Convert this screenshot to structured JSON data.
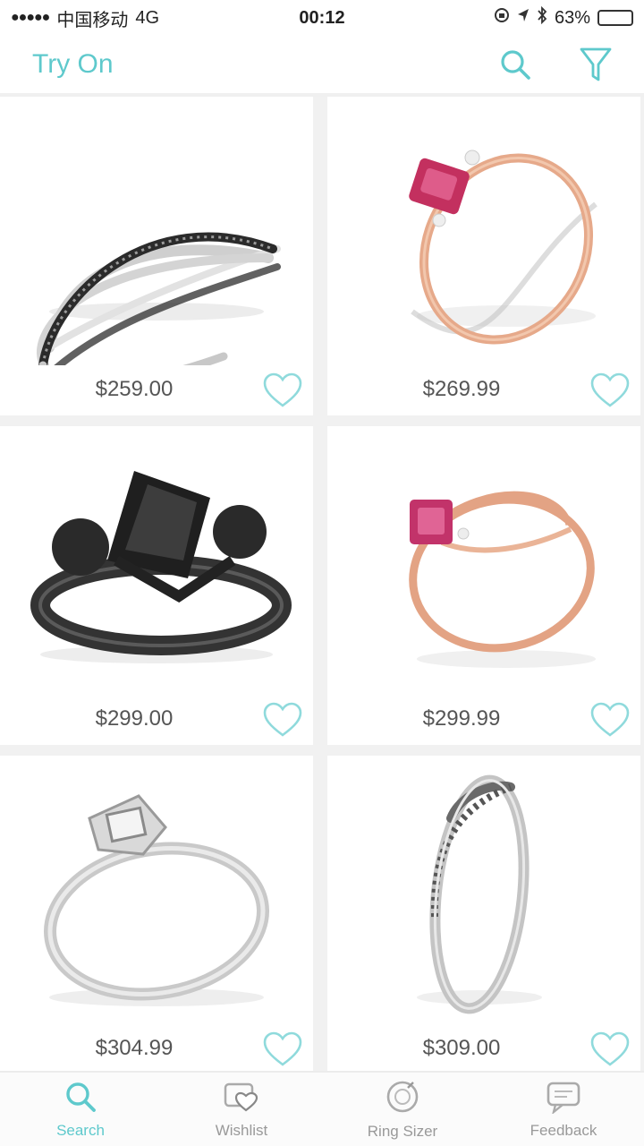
{
  "status_bar": {
    "carrier": "中国移动",
    "network": "4G",
    "time": "00:12",
    "battery": "63%"
  },
  "nav": {
    "title": "Try On",
    "icons": [
      "search-icon",
      "filter-icon"
    ]
  },
  "products": [
    {
      "price": "$259.00",
      "ring": "silver-black-twist-band"
    },
    {
      "price": "$269.99",
      "ring": "rose-gold-ruby-ring"
    },
    {
      "price": "$299.00",
      "ring": "black-princess-cut-ring"
    },
    {
      "price": "$299.99",
      "ring": "rose-gold-split-shank-ruby-ring"
    },
    {
      "price": "$304.99",
      "ring": "silver-halo-ring"
    },
    {
      "price": "$309.00",
      "ring": "silver-curved-pave-band"
    }
  ],
  "tabs": [
    {
      "label": "Search",
      "icon": "search-icon",
      "active": true
    },
    {
      "label": "Wishlist",
      "icon": "wishlist-icon",
      "active": false
    },
    {
      "label": "Ring Sizer",
      "icon": "ring-sizer-icon",
      "active": false
    },
    {
      "label": "Feedback",
      "icon": "feedback-icon",
      "active": false
    }
  ],
  "colors": {
    "accent": "#5ec9cc",
    "background": "#f1f1f1",
    "battery": "#f5c518"
  }
}
